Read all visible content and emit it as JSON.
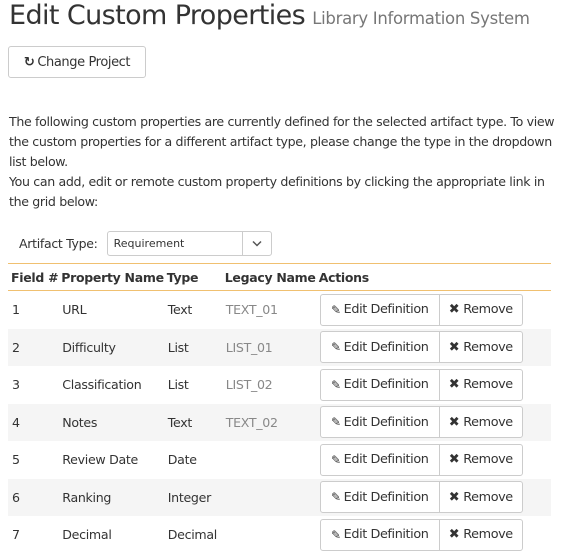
{
  "header": {
    "title": "Edit Custom Properties",
    "subtitle": "Library Information System"
  },
  "toolbar": {
    "change_project_label": "Change Project",
    "change_project_icon": "refresh-icon"
  },
  "intro": {
    "paragraph1": "The following custom properties are currently defined for the selected artifact type. To view the custom properties for a different artifact type, please change the type in the dropdown list below.",
    "paragraph2": "You can add, edit or remote custom property definitions by clicking the appropriate link in the grid below:"
  },
  "filter": {
    "label": "Artifact Type:",
    "selected": "Requirement",
    "icon": "chevron-down-icon"
  },
  "grid": {
    "columns": [
      "Field #",
      "Property Name",
      "Type",
      "Legacy Name",
      "Actions"
    ],
    "edit_label": "Edit Definition",
    "remove_label": "Remove",
    "edit_icon": "edit-icon",
    "remove_icon": "close-icon",
    "rows": [
      {
        "field": "1",
        "name": "URL",
        "type": "Text",
        "legacy": "TEXT_01"
      },
      {
        "field": "2",
        "name": "Difficulty",
        "type": "List",
        "legacy": "LIST_01"
      },
      {
        "field": "3",
        "name": "Classification",
        "type": "List",
        "legacy": "LIST_02"
      },
      {
        "field": "4",
        "name": "Notes",
        "type": "Text",
        "legacy": "TEXT_02"
      },
      {
        "field": "5",
        "name": "Review Date",
        "type": "Date",
        "legacy": ""
      },
      {
        "field": "6",
        "name": "Ranking",
        "type": "Integer",
        "legacy": ""
      },
      {
        "field": "7",
        "name": "Decimal",
        "type": "Decimal",
        "legacy": ""
      }
    ]
  },
  "colors": {
    "header_border": "#f0c070",
    "row_alt": "#f5f5f5",
    "legacy_text": "#888888"
  }
}
